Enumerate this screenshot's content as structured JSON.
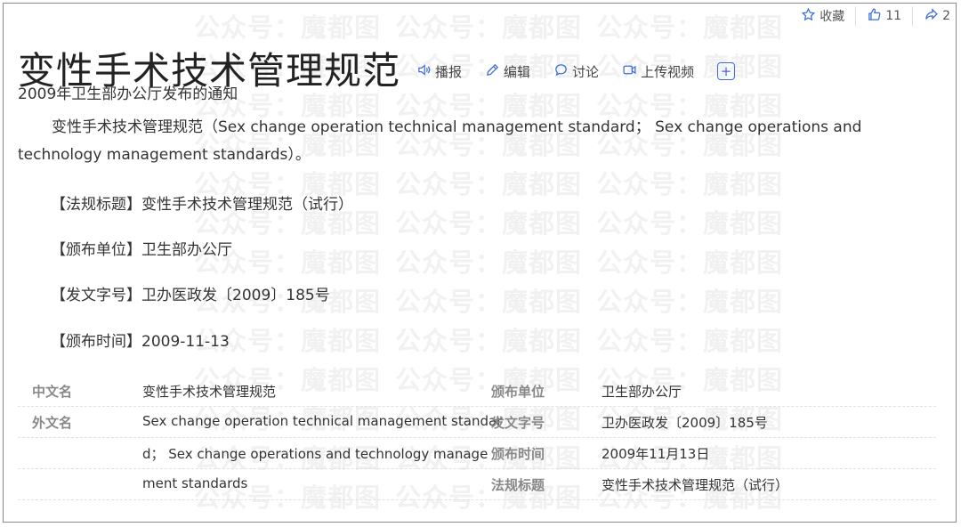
{
  "toolbar": {
    "collect_label": "收藏",
    "like_count": "11",
    "share_count": "2"
  },
  "title": "变性手术技术管理规范",
  "actions": {
    "play": "播报",
    "edit": "编辑",
    "discuss": "讨论",
    "upload_video": "上传视频",
    "add": "+"
  },
  "subtitle": "2009年卫生部办公厅发布的通知",
  "summary": "变性手术技术管理规范（Sex change operation technical management standard； Sex change operations and technology management standards）。",
  "meta": [
    "【法规标题】变性手术技术管理规范（试行）",
    "【颁布单位】卫生部办公厅",
    "【发文字号】卫办医政发〔2009〕185号",
    "【颁布时间】2009-11-13"
  ],
  "basic_info": {
    "left": [
      {
        "label": "中文名",
        "value": "变性手术技术管理规范"
      },
      {
        "label": "外文名",
        "value": "Sex change operation technical management standar"
      },
      {
        "label": "",
        "value": "d； Sex change operations and technology manage"
      },
      {
        "label": "",
        "value": "ment standards"
      }
    ],
    "right": [
      {
        "label": "颁布单位",
        "value": "卫生部办公厅"
      },
      {
        "label": "发文字号",
        "value": "卫办医政发〔2009〕185号"
      },
      {
        "label": "颁布时间",
        "value": "2009年11月13日"
      },
      {
        "label": "法规标题",
        "value": "变性手术技术管理规范（试行）"
      }
    ]
  },
  "watermark": [
    "公众号：",
    "魔都图"
  ],
  "colors": {
    "accent": "#3d6cdc",
    "label_gray": "#888888"
  }
}
